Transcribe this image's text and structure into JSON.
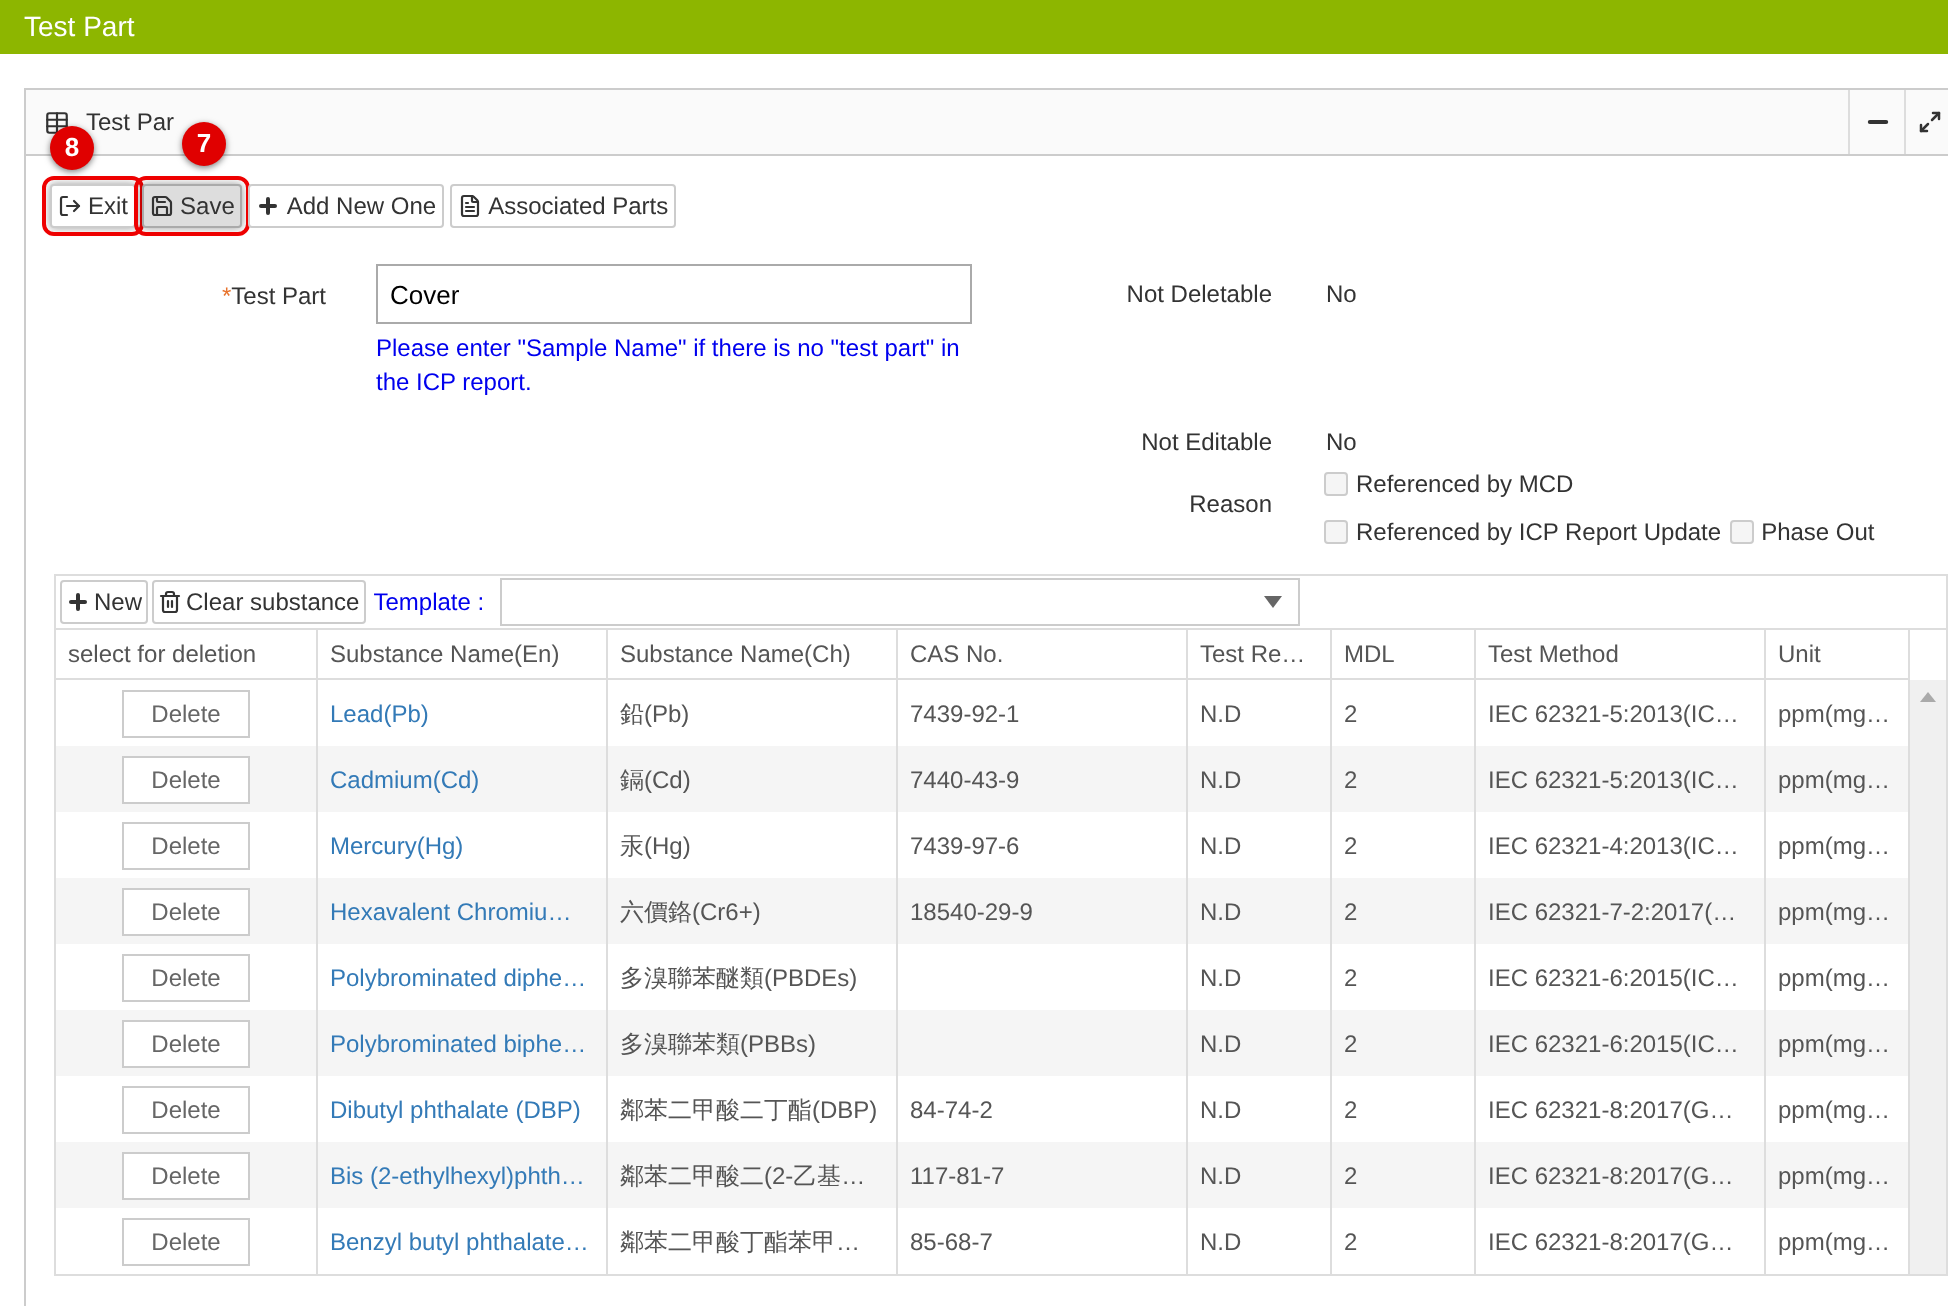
{
  "app_bar": {
    "title": "Test Part"
  },
  "panel": {
    "title": "Test Par"
  },
  "toolbar": [
    {
      "kind": "exit",
      "label": "Exit",
      "highlighted": true,
      "pressed": false,
      "callout": "8"
    },
    {
      "kind": "save",
      "label": "Save",
      "highlighted": true,
      "pressed": true,
      "callout": "7"
    },
    {
      "kind": "add",
      "label": "Add New One",
      "highlighted": false,
      "pressed": false
    },
    {
      "kind": "doc",
      "label": "Associated Parts",
      "highlighted": false,
      "pressed": false
    }
  ],
  "form": {
    "test_part": {
      "label": "Test Part",
      "required_mark": "*",
      "value": "Cover",
      "hint": "Please enter \"Sample Name\" if there is no \"test part\" in the ICP report."
    },
    "not_deletable": {
      "label": "Not Deletable",
      "value": "No"
    },
    "not_editable": {
      "label": "Not Editable",
      "value": "No"
    },
    "reason": {
      "label": "Reason",
      "options": [
        {
          "label": "Referenced by MCD",
          "checked": false
        },
        {
          "label": "Referenced by ICP Report Update",
          "checked": false
        },
        {
          "label": "Phase Out",
          "checked": false
        }
      ]
    }
  },
  "grid_toolbar": {
    "buttons": [
      {
        "kind": "add",
        "label": "New"
      },
      {
        "kind": "trash",
        "label": "Clear substance"
      }
    ],
    "template_label": "Template :"
  },
  "table": {
    "columns": [
      "select for deletion",
      "Substance Name(En)",
      "Substance Name(Ch)",
      "CAS No.",
      "Test Re…",
      "MDL",
      "Test Method",
      "Unit"
    ],
    "rows": [
      {
        "cells": [
          "Delete",
          "Lead(Pb)",
          "鉛(Pb)",
          "7439-92-1",
          "N.D",
          "2",
          "IEC 62321-5:2013(IC…",
          "ppm(mg…"
        ]
      },
      {
        "cells": [
          "Delete",
          "Cadmium(Cd)",
          "鎘(Cd)",
          "7440-43-9",
          "N.D",
          "2",
          "IEC 62321-5:2013(IC…",
          "ppm(mg…"
        ]
      },
      {
        "cells": [
          "Delete",
          "Mercury(Hg)",
          "汞(Hg)",
          "7439-97-6",
          "N.D",
          "2",
          "IEC 62321-4:2013(IC…",
          "ppm(mg…"
        ]
      },
      {
        "cells": [
          "Delete",
          "Hexavalent Chromiu…",
          "六價鉻(Cr6+)",
          "18540-29-9",
          "N.D",
          "2",
          "IEC 62321-7-2:2017(…",
          "ppm(mg…"
        ]
      },
      {
        "cells": [
          "Delete",
          "Polybrominated diphe…",
          "多溴聯苯醚類(PBDEs)",
          "",
          "N.D",
          "2",
          "IEC 62321-6:2015(IC…",
          "ppm(mg…"
        ]
      },
      {
        "cells": [
          "Delete",
          "Polybrominated biphe…",
          "多溴聯苯類(PBBs)",
          "",
          "N.D",
          "2",
          "IEC 62321-6:2015(IC…",
          "ppm(mg…"
        ]
      },
      {
        "cells": [
          "Delete",
          "Dibutyl phthalate (DBP)",
          "鄰苯二甲酸二丁酯(DBP)",
          "84-74-2",
          "N.D",
          "2",
          "IEC 62321-8:2017(G…",
          "ppm(mg…"
        ]
      },
      {
        "cells": [
          "Delete",
          "Bis (2-ethylhexyl)phth…",
          "鄰苯二甲酸二(2-乙基…",
          "117-81-7",
          "N.D",
          "2",
          "IEC 62321-8:2017(G…",
          "ppm(mg…"
        ]
      },
      {
        "cells": [
          "Delete",
          "Benzyl butyl phthalate…",
          "鄰苯二甲酸丁酯苯甲…",
          "85-68-7",
          "N.D",
          "2",
          "IEC 62321-8:2017(G…",
          "ppm(mg…"
        ]
      }
    ]
  }
}
